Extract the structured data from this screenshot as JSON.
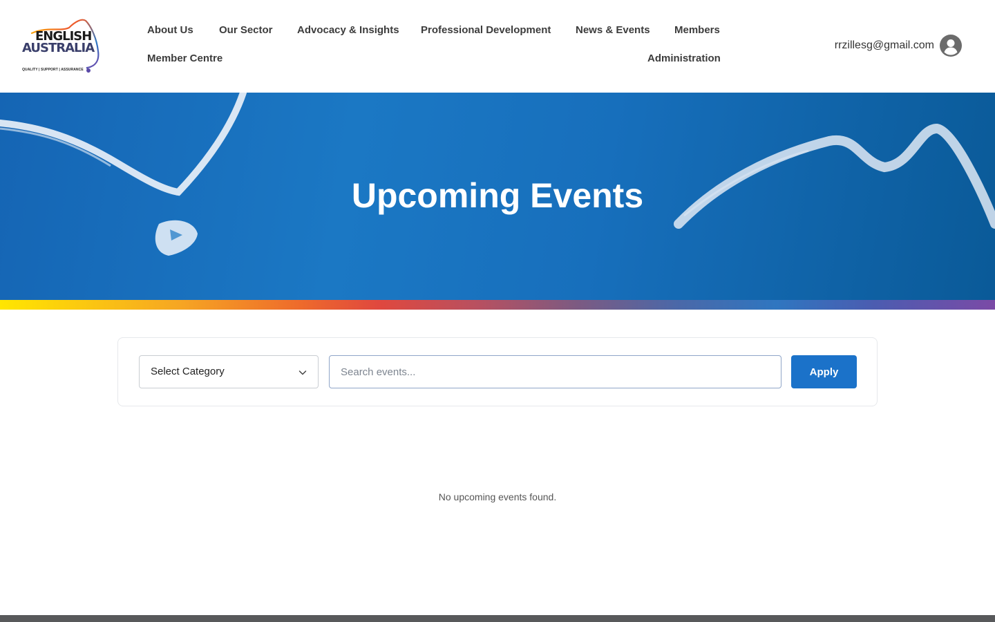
{
  "logo": {
    "line1": "ENGLISH",
    "line2": "AUSTRALIA",
    "tagline": "QUALITY | SUPPORT | ASSURANCE"
  },
  "nav": {
    "about": "About Us",
    "sector": "Our Sector",
    "advocacy": "Advocacy & Insights",
    "pd": "Professional Development",
    "news": "News & Events",
    "members": "Members",
    "member_centre": "Member Centre",
    "administration": "Administration"
  },
  "user": {
    "email": "rrzillesg@gmail.com",
    "avatar_icon": "user-circle-icon"
  },
  "hero": {
    "title": "Upcoming Events"
  },
  "filters": {
    "category_label": "Select Category",
    "search_placeholder": "Search events...",
    "search_value": "",
    "apply_label": "Apply"
  },
  "results": {
    "empty_message": "No upcoming events found."
  },
  "colors": {
    "brand_blue": "#1b72c9",
    "hero_blue": "#1b78c4",
    "footer_gray": "#58595b"
  }
}
